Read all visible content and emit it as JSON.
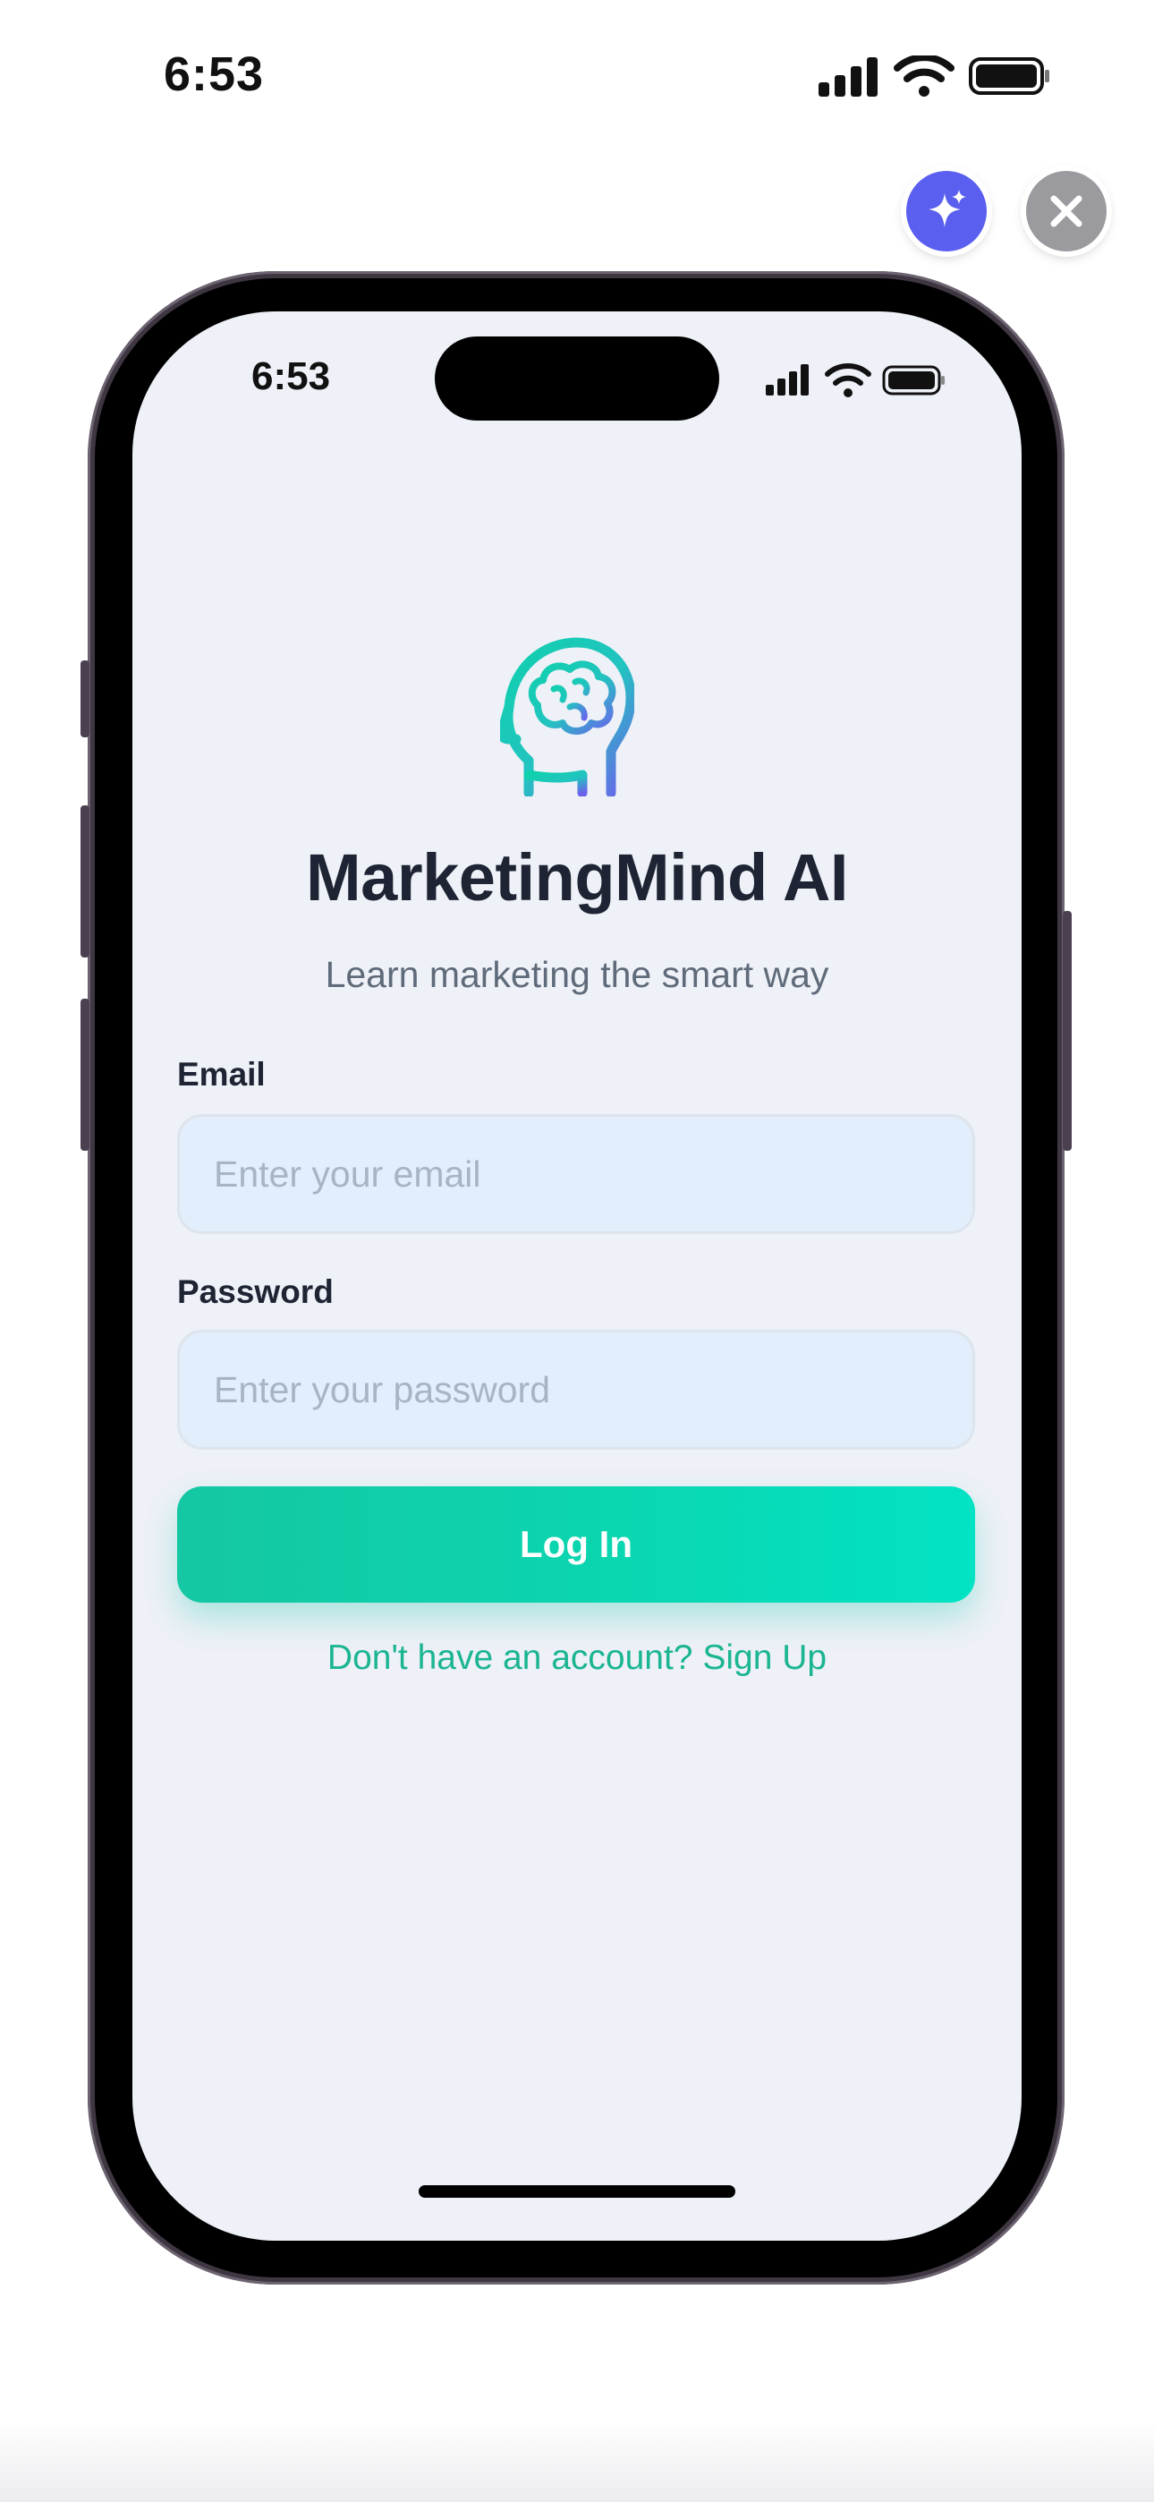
{
  "device_status_bar": {
    "time": "6:53"
  },
  "floating_actions": {
    "ai_icon": "sparkles-icon",
    "close_icon": "close-icon"
  },
  "app_status_bar": {
    "time": "6:53"
  },
  "login_screen": {
    "logo_icon": "brain-head-icon",
    "title": "MarketingMind AI",
    "tagline": "Learn marketing the smart way",
    "email": {
      "label": "Email",
      "placeholder": "Enter your email",
      "value": ""
    },
    "password": {
      "label": "Password",
      "placeholder": "Enter your password",
      "value": ""
    },
    "login_button": "Log In",
    "signup_link": "Don't have an account? Sign Up"
  },
  "colors": {
    "accent": "#14c9a6",
    "ai_button": "#5a5fef",
    "close_button": "#9b9b9f",
    "screen_background": "#eef1f7",
    "input_background": "#e2eefb",
    "title_text": "#1e2433"
  }
}
